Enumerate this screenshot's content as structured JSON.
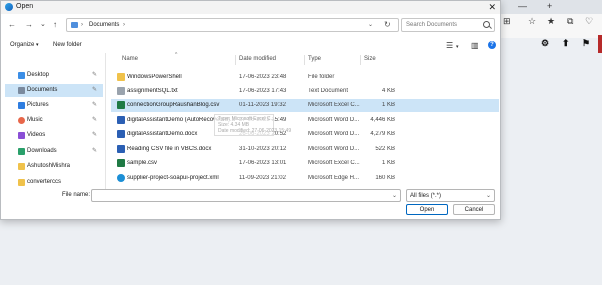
{
  "dialog": {
    "title": "Open",
    "close_glyph": "✕"
  },
  "nav": {
    "back": "←",
    "forward": "→",
    "recent": "⌄",
    "up": "↑",
    "separator": "›",
    "breadcrumb": "Documents",
    "dropdown": "⌄",
    "refresh": "↻",
    "search_placeholder": "Search Documents"
  },
  "toolbar": {
    "organize": "Organize",
    "organize_caret": "▾",
    "new_folder": "New folder",
    "view_glyph": "☰",
    "view_caret": "▾",
    "pane_glyph": "▥",
    "help": "?"
  },
  "sidebar": [
    {
      "label": "Desktop",
      "icon": "desktop-icon",
      "color": "#3b8ee6",
      "pinned": true
    },
    {
      "label": "Documents",
      "icon": "documents-icon",
      "color": "#7a8a9e",
      "pinned": true,
      "selected": true
    },
    {
      "label": "Pictures",
      "icon": "pictures-icon",
      "color": "#2e7de0",
      "pinned": true
    },
    {
      "label": "Music",
      "icon": "music-icon",
      "color": "#e8674a",
      "pinned": true
    },
    {
      "label": "Videos",
      "icon": "videos-icon",
      "color": "#8a4fd6",
      "pinned": true
    },
    {
      "label": "Downloads",
      "icon": "downloads-icon",
      "color": "#2aa06b",
      "pinned": true
    },
    {
      "label": "AshutoshMishra",
      "icon": "folder-icon",
      "color": "#f0c24b",
      "pinned": false
    },
    {
      "label": "converterccs",
      "icon": "folder-icon",
      "color": "#f0c24b",
      "pinned": false
    }
  ],
  "columns": {
    "name": "Name",
    "date": "Date modified",
    "type": "Type",
    "size": "Size",
    "sort_caret": "^"
  },
  "files": [
    {
      "name": "WindowsPowerShell",
      "date": "17-06-2023 23:48",
      "type": "File folder",
      "size": "",
      "icon": "folder-icon",
      "color": "#f0c24b"
    },
    {
      "name": "assignmentSQL.txt",
      "date": "17-06-2023 17:43",
      "type": "Text Document",
      "size": "4 KB",
      "icon": "text-file-icon",
      "color": "#9aa3ad"
    },
    {
      "name": "connectionGroupRaushanBlog.csv",
      "date": "01-11-2023 19:32",
      "type": "Microsoft Excel C...",
      "size": "1 KB",
      "icon": "excel-file-icon",
      "color": "#1f7a45",
      "selected": true
    },
    {
      "name": "digitalAssistantDemo (AutoRecovered).d...",
      "date": "27-06-2023 15:49",
      "type": "Microsoft Word D...",
      "size": "4,446 KB",
      "icon": "word-file-icon",
      "color": "#2b5fb4"
    },
    {
      "name": "digitalAssistantDemo.docx",
      "date": "26-06-2023 20:52",
      "type": "Microsoft Word D...",
      "size": "4,279 KB",
      "icon": "word-file-icon",
      "color": "#2b5fb4"
    },
    {
      "name": "Reading CSV file in VBCS.docx",
      "date": "31-10-2023 20:12",
      "type": "Microsoft Word D...",
      "size": "522 KB",
      "icon": "word-file-icon",
      "color": "#2b5fb4"
    },
    {
      "name": "sample.csv",
      "date": "17-06-2023 13:01",
      "type": "Microsoft Excel C...",
      "size": "1 KB",
      "icon": "excel-file-icon",
      "color": "#1f7a45"
    },
    {
      "name": "supplier-project-soapui-project.xml",
      "date": "11-09-2023 21:02",
      "type": "Microsoft Edge H...",
      "size": "160 KB",
      "icon": "edge-file-icon",
      "color": "#1c8fd6"
    }
  ],
  "tooltip": {
    "line1": "Type: Microsoft Excel C...",
    "line2": "Size: 4.34 MB",
    "line3": "Date modified: 27-06-2023 15:49"
  },
  "footer": {
    "filename_label": "File name:",
    "filename_value": "",
    "filter_value": "All files (*.*)",
    "dropdown": "⌄",
    "open": "Open",
    "cancel": "Cancel"
  },
  "browser": {
    "minimize": "—",
    "new_tab": "+",
    "icons": [
      "⊞",
      "☆",
      "★",
      "⧉",
      "♡",
      "⚙",
      "⬆",
      "⚑"
    ]
  }
}
